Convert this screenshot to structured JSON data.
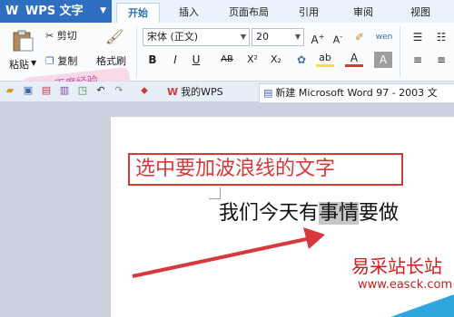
{
  "app": {
    "name": "WPS 文字",
    "logo": "W"
  },
  "tabs": [
    {
      "label": "开始",
      "active": true
    },
    {
      "label": "插入"
    },
    {
      "label": "页面布局"
    },
    {
      "label": "引用"
    },
    {
      "label": "审阅"
    },
    {
      "label": "视图"
    }
  ],
  "ribbon": {
    "paste_label": "粘贴",
    "cut_label": "剪切",
    "copy_label": "复制",
    "format_painter_label": "格式刷",
    "font_name": "宋体 (正文)",
    "font_size": "20",
    "grow_font": "A",
    "shrink_font": "A",
    "clear_format": "✐",
    "pinyin": "wen",
    "bold": "B",
    "italic": "I",
    "underline": "U",
    "strikethrough": "AB",
    "superscript": "X²",
    "subscript": "X₂",
    "highlight": "ab",
    "font_color": "A",
    "char_shading": "A"
  },
  "quickbar": {
    "doc_tab_1": "我的WPS",
    "doc_tab_2": "新建 Microsoft Word 97 - 2003 文"
  },
  "document": {
    "callout": "选中要加波浪线的文字",
    "line_prefix": "我们今天有",
    "line_selected": "事情",
    "line_suffix": "要做"
  },
  "watermark": {
    "site": "易采站长站",
    "url": "www.easck.com"
  },
  "stamp": "百度经验",
  "colors": {
    "accent": "#2f6fc2",
    "callout": "#d8383a",
    "selection": "#c7c7c7"
  }
}
